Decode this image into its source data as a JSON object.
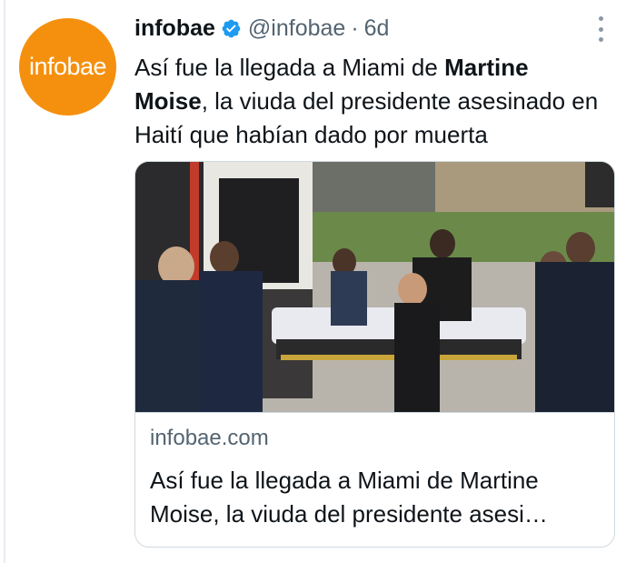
{
  "tweet": {
    "avatar_text": "infobae",
    "display_name": "infobae",
    "handle": "@infobae",
    "separator": "·",
    "time": "6d",
    "text_before": "Así fue la llegada a Miami de ",
    "text_bold": "Martine Moise",
    "text_after": ", la viuda del presidente asesinado en Haití que habían dado por muerta"
  },
  "card": {
    "domain": "infobae.com",
    "title_line1": "Así fue la llegada a Miami de Martine",
    "title_line2": "Moise, la viuda del presidente asesi…"
  },
  "colors": {
    "avatar_bg": "#f5900e",
    "verified": "#1d9bf0",
    "secondary_text": "#536471",
    "border": "#cfd9de"
  },
  "icons": {
    "verified": "verified-badge-icon",
    "more": "more-vertical-icon"
  }
}
